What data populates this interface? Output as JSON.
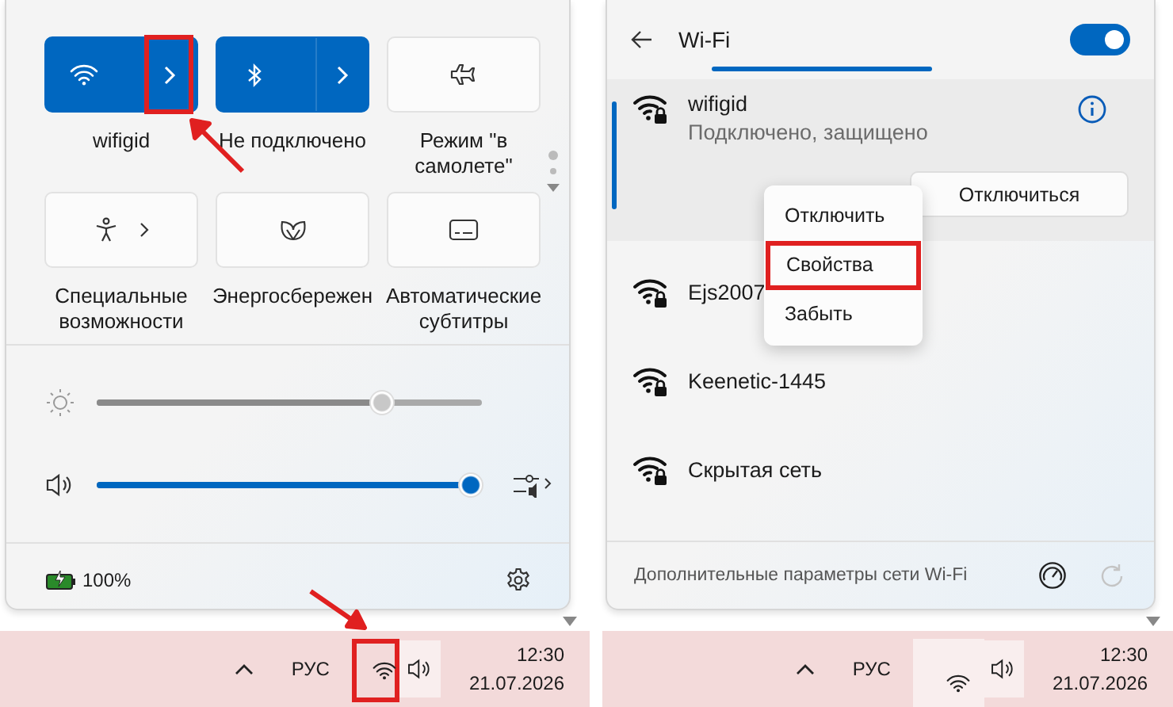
{
  "quick_settings": {
    "tiles": [
      {
        "kind": "wifi",
        "label": "wifigid",
        "on": true,
        "marked": true
      },
      {
        "kind": "bluetooth",
        "label": "Не подключено",
        "on": true,
        "marked": false
      },
      {
        "kind": "airplane",
        "label": "Режим \"в самолете\"",
        "on": false,
        "marked": false
      },
      {
        "kind": "accessibility",
        "label": "Специальные возможности",
        "on": false,
        "marked": false
      },
      {
        "kind": "energy",
        "label": "Энергосбережен",
        "on": false,
        "marked": false
      },
      {
        "kind": "captions",
        "label": "Автоматические субтитры",
        "on": false,
        "marked": false
      }
    ],
    "sliders": [
      {
        "kind": "brightness",
        "level": 0.74
      },
      {
        "kind": "volume",
        "level": 0.97
      }
    ],
    "battery": "100%"
  },
  "wifi_panel": {
    "title": "Wi-Fi",
    "on": true,
    "networks": [
      {
        "name": "wifigid",
        "status": "Подключено, защищено",
        "selected": true,
        "action": "Отключиться"
      },
      {
        "name": "Ejs2007",
        "selected": false
      },
      {
        "name": "Keenetic-1445",
        "selected": false
      },
      {
        "name": "Скрытая сеть",
        "selected": false
      }
    ],
    "context_menu": [
      {
        "label": "Отключить",
        "marked": false
      },
      {
        "label": "Свойства",
        "marked": true
      },
      {
        "label": "Забыть",
        "marked": false
      }
    ],
    "footer": "Дополнительные параметры сети Wi-Fi",
    "refresh_disabled": true
  },
  "taskbars": [
    {
      "language": "РУС",
      "time": "12:30",
      "date": "21.07.2026",
      "network_hovered": false,
      "volume_hovered": true,
      "marked": true
    },
    {
      "language": "РУС",
      "time": "12:30",
      "date": "21.07.2026",
      "network_hovered": true,
      "volume_hovered": true,
      "marked": false
    }
  ]
}
